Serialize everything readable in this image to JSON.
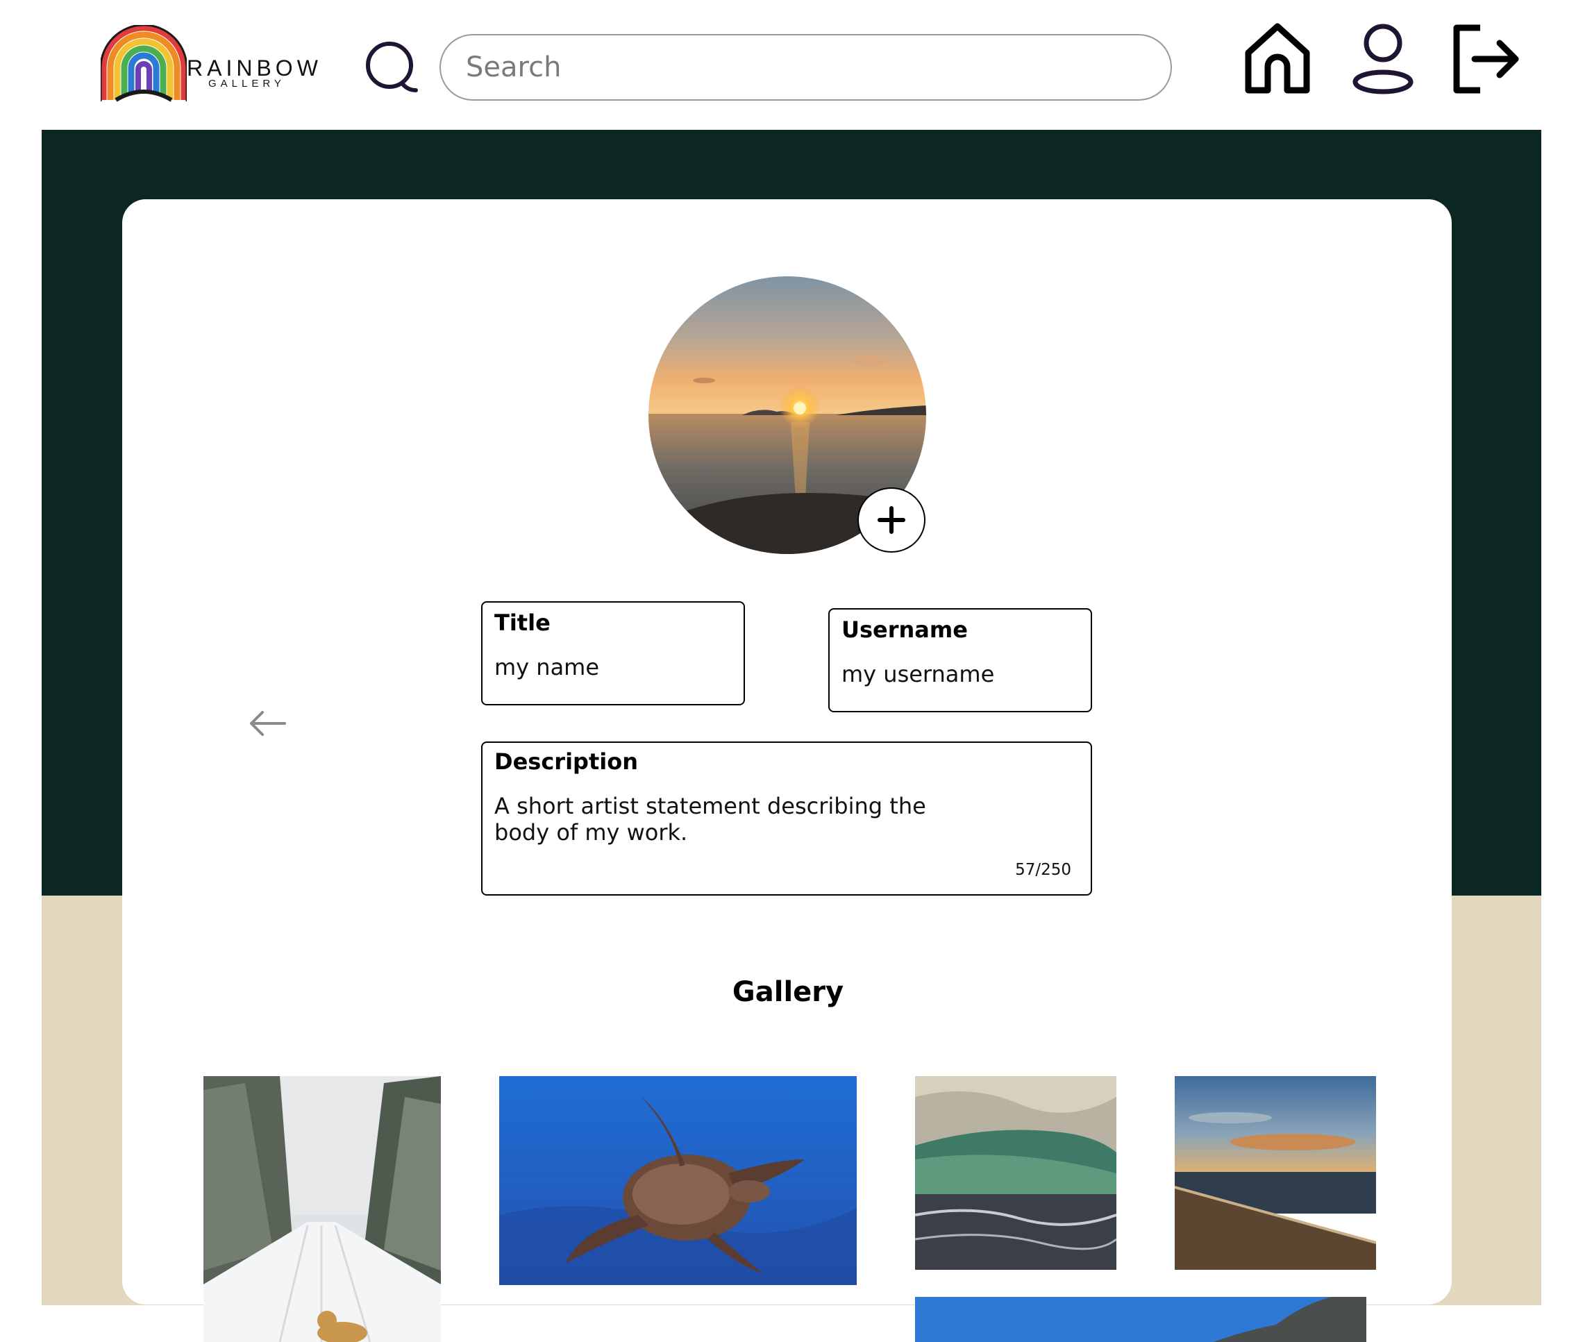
{
  "brand": {
    "name": "RAINBOW",
    "subtitle": "GALLERY"
  },
  "search": {
    "placeholder": "Search",
    "value": ""
  },
  "nav": {
    "home": "home-icon",
    "profile": "user-icon",
    "logout": "logout-icon"
  },
  "colors": {
    "dark_band": "#0c2621",
    "tan_band": "#e3d8bf",
    "card": "#ffffff",
    "accent_icon": "#1f1433"
  },
  "profile": {
    "title_label": "Title",
    "title_value": "my name",
    "username_label": "Username",
    "username_value": "my username",
    "description_label": "Description",
    "description_value": "A short artist statement describing the body of my work.",
    "char_count": "57/250"
  },
  "gallery": {
    "heading": "Gallery",
    "items": [
      "snowy-road-dog",
      "sea-turtle",
      "ocean-wave",
      "beach-sunset",
      "mountain-sky"
    ]
  }
}
